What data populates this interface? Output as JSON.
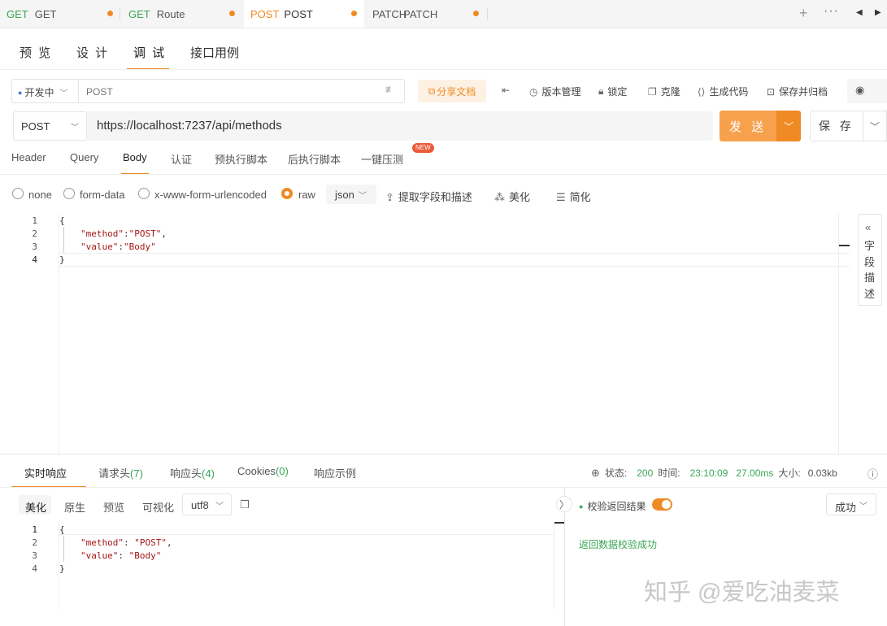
{
  "request_tabs": [
    {
      "method": "GET",
      "name": "GET"
    },
    {
      "method": "GET",
      "name": "Route"
    },
    {
      "method": "POST",
      "name": "POST"
    },
    {
      "method": "PATCH",
      "name": "PATCH"
    }
  ],
  "page_tabs": [
    "预 览",
    "设 计",
    "调 试",
    "接口用例"
  ],
  "env": {
    "label": "开发中",
    "name_placeholder": "POST"
  },
  "toolbar": {
    "share": "分享文档",
    "version": "版本管理",
    "lock": "锁定",
    "clone": "克隆",
    "gen_code": "生成代码",
    "save_archive": "保存并归档"
  },
  "request": {
    "method": "POST",
    "url": "https://localhost:7237/api/methods",
    "send_label": "发 送",
    "save_label": "保 存"
  },
  "body_tabs": [
    "Header",
    "Query",
    "Body",
    "认证",
    "预执行脚本",
    "后执行脚本",
    "一键压测"
  ],
  "new_badge": "NEW",
  "body_types": [
    "none",
    "form-data",
    "x-www-form-urlencoded",
    "raw"
  ],
  "body_format": "json",
  "body_tools": {
    "extract": "提取字段和描述",
    "beautify": "美化",
    "simplify": "简化"
  },
  "side_panel": {
    "label": "字段描述"
  },
  "request_body": {
    "lines": [
      "1",
      "2",
      "3",
      "4"
    ],
    "open": "{",
    "k1": "\"method\"",
    "v1": "\"POST\"",
    "k2": "\"value\"",
    "v2": "\"Body\"",
    "close": "}"
  },
  "response_tabs": [
    "实时响应",
    "请求头",
    "响应头",
    "Cookies",
    "响应示例"
  ],
  "response_counts": {
    "req_headers": "(7)",
    "resp_headers": "(4)",
    "cookies": "(0)"
  },
  "status": {
    "status_label": "状态:",
    "status_value": "200",
    "time_label": "时间:",
    "time_value": "23:10:09",
    "duration": "27.00ms",
    "size_label": "大小:",
    "size_value": "0.03kb"
  },
  "view_tabs": [
    "美化",
    "原生",
    "预览",
    "可视化"
  ],
  "encoding": "utf8",
  "response_body": {
    "lines": [
      "1",
      "2",
      "3",
      "4"
    ],
    "open": "{",
    "k1": "\"method\"",
    "v1": "\"POST\"",
    "k2": "\"value\"",
    "v2": "\"Body\"",
    "close": "}"
  },
  "validation": {
    "label": "校验返回结果",
    "result_select": "成功",
    "message": "返回数据校验成功"
  },
  "watermark": "知乎 @爱吃油麦菜",
  "colors": {
    "accent": "#f08a24",
    "get": "#3aa655",
    "success": "#3aa655"
  }
}
